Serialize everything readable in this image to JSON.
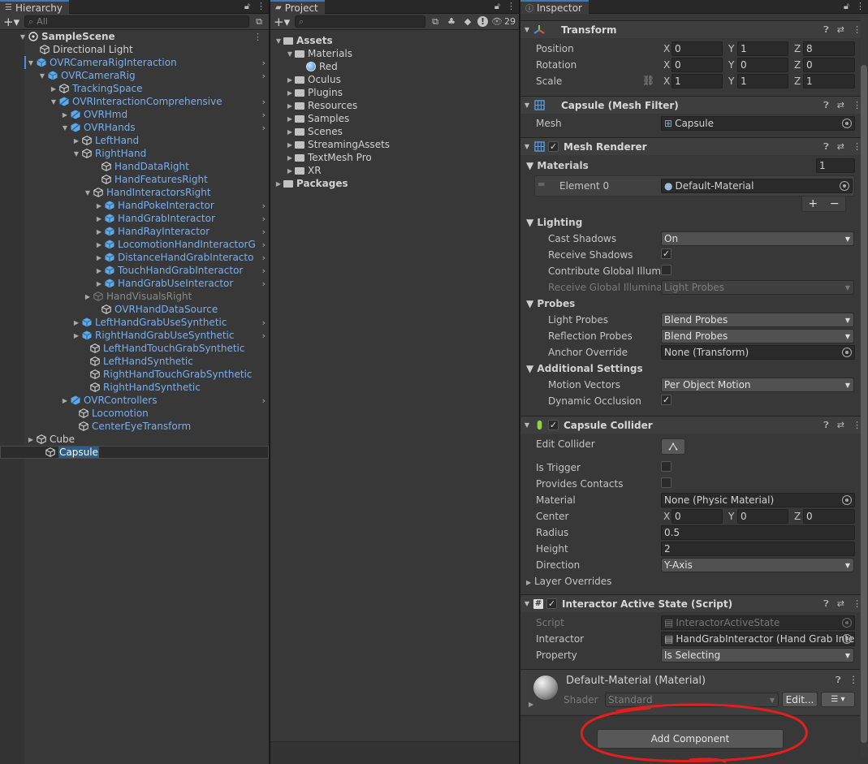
{
  "hierarchy": {
    "tab": "Hierarchy",
    "search_placeholder": "All",
    "rows": [
      {
        "label": "SampleScene",
        "depth": 0
      },
      {
        "label": "Directional Light"
      },
      {
        "label": "OVRCameraRigInteraction"
      },
      {
        "label": "OVRCameraRig"
      },
      {
        "label": "TrackingSpace"
      },
      {
        "label": "OVRInteractionComprehensive"
      },
      {
        "label": "OVRHmd"
      },
      {
        "label": "OVRHands"
      },
      {
        "label": "LeftHand"
      },
      {
        "label": "RightHand"
      },
      {
        "label": "HandDataRight"
      },
      {
        "label": "HandFeaturesRight"
      },
      {
        "label": "HandInteractorsRight"
      },
      {
        "label": "HandPokeInteractor"
      },
      {
        "label": "HandGrabInteractor"
      },
      {
        "label": "HandRayInteractor"
      },
      {
        "label": "LocomotionHandInteractorG"
      },
      {
        "label": "DistanceHandGrabInteracto"
      },
      {
        "label": "TouchHandGrabInteractor"
      },
      {
        "label": "HandGrabUseInteractor"
      },
      {
        "label": "HandVisualsRight"
      },
      {
        "label": "OVRHandDataSource"
      },
      {
        "label": "LeftHandGrabUseSynthetic"
      },
      {
        "label": "RightHandGrabUseSynthetic"
      },
      {
        "label": "LeftHandTouchGrabSynthetic"
      },
      {
        "label": "LeftHandSynthetic"
      },
      {
        "label": "RightHandTouchGrabSynthetic"
      },
      {
        "label": "RightHandSynthetic"
      },
      {
        "label": "OVRControllers"
      },
      {
        "label": "Locomotion"
      },
      {
        "label": "CenterEyeTransform"
      },
      {
        "label": "Cube"
      },
      {
        "label": "Capsule"
      }
    ]
  },
  "project": {
    "tab": "Project",
    "count": "29",
    "rows": [
      {
        "label": "Assets"
      },
      {
        "label": "Materials"
      },
      {
        "label": "Red"
      },
      {
        "label": "Oculus"
      },
      {
        "label": "Plugins"
      },
      {
        "label": "Resources"
      },
      {
        "label": "Samples"
      },
      {
        "label": "Scenes"
      },
      {
        "label": "StreamingAssets"
      },
      {
        "label": "TextMesh Pro"
      },
      {
        "label": "XR"
      },
      {
        "label": "Packages"
      }
    ]
  },
  "inspector": {
    "tab": "Inspector",
    "transform": {
      "title": "Transform",
      "position_label": "Position",
      "rotation_label": "Rotation",
      "scale_label": "Scale",
      "axes": {
        "x": "X",
        "y": "Y",
        "z": "Z"
      },
      "position": {
        "x": "0",
        "y": "1",
        "z": "8"
      },
      "rotation": {
        "x": "0",
        "y": "0",
        "z": "0"
      },
      "scale": {
        "x": "1",
        "y": "1",
        "z": "1"
      }
    },
    "mesh_filter": {
      "title": "Capsule (Mesh Filter)",
      "mesh_label": "Mesh",
      "mesh_value": "Capsule"
    },
    "mesh_renderer": {
      "title": "Mesh Renderer",
      "materials_label": "Materials",
      "materials_count": "1",
      "element0_label": "Element 0",
      "element0_value": "Default-Material",
      "lighting_label": "Lighting",
      "cast_shadows_label": "Cast Shadows",
      "cast_shadows_value": "On",
      "receive_shadows_label": "Receive Shadows",
      "contribute_gi_label": "Contribute Global Illumin",
      "receive_gi_label": "Receive Global Illuminati",
      "receive_gi_value": "Light Probes",
      "probes_label": "Probes",
      "light_probes_label": "Light Probes",
      "light_probes_value": "Blend Probes",
      "reflection_probes_label": "Reflection Probes",
      "reflection_probes_value": "Blend Probes",
      "anchor_override_label": "Anchor Override",
      "anchor_override_value": "None (Transform)",
      "additional_label": "Additional Settings",
      "motion_vectors_label": "Motion Vectors",
      "motion_vectors_value": "Per Object Motion",
      "dynamic_occlusion_label": "Dynamic Occlusion",
      "add_label": "+",
      "remove_label": "−"
    },
    "capsule_collider": {
      "title": "Capsule Collider",
      "edit_collider_label": "Edit Collider",
      "is_trigger_label": "Is Trigger",
      "provides_contacts_label": "Provides Contacts",
      "material_label": "Material",
      "material_value": "None (Physic Material)",
      "center_label": "Center",
      "center": {
        "x": "0",
        "y": "0",
        "z": "0"
      },
      "radius_label": "Radius",
      "radius_value": "0.5",
      "height_label": "Height",
      "height_value": "2",
      "direction_label": "Direction",
      "direction_value": "Y-Axis",
      "layer_overrides_label": "Layer Overrides"
    },
    "interactor_active_state": {
      "title": "Interactor Active State (Script)",
      "script_label": "Script",
      "script_value": "InteractorActiveState",
      "interactor_label": "Interactor",
      "interactor_value": "HandGrabInteractor (Hand Grab Intera",
      "property_label": "Property",
      "property_value": "Is Selecting"
    },
    "material": {
      "title": "Default-Material (Material)",
      "shader_label": "Shader",
      "shader_value": "Standard",
      "edit_label": "Edit..."
    },
    "add_component_label": "Add Component"
  },
  "colors": {
    "annotation": "#e0201c",
    "selection": "#2c5d87",
    "accent": "#3a79bb"
  }
}
